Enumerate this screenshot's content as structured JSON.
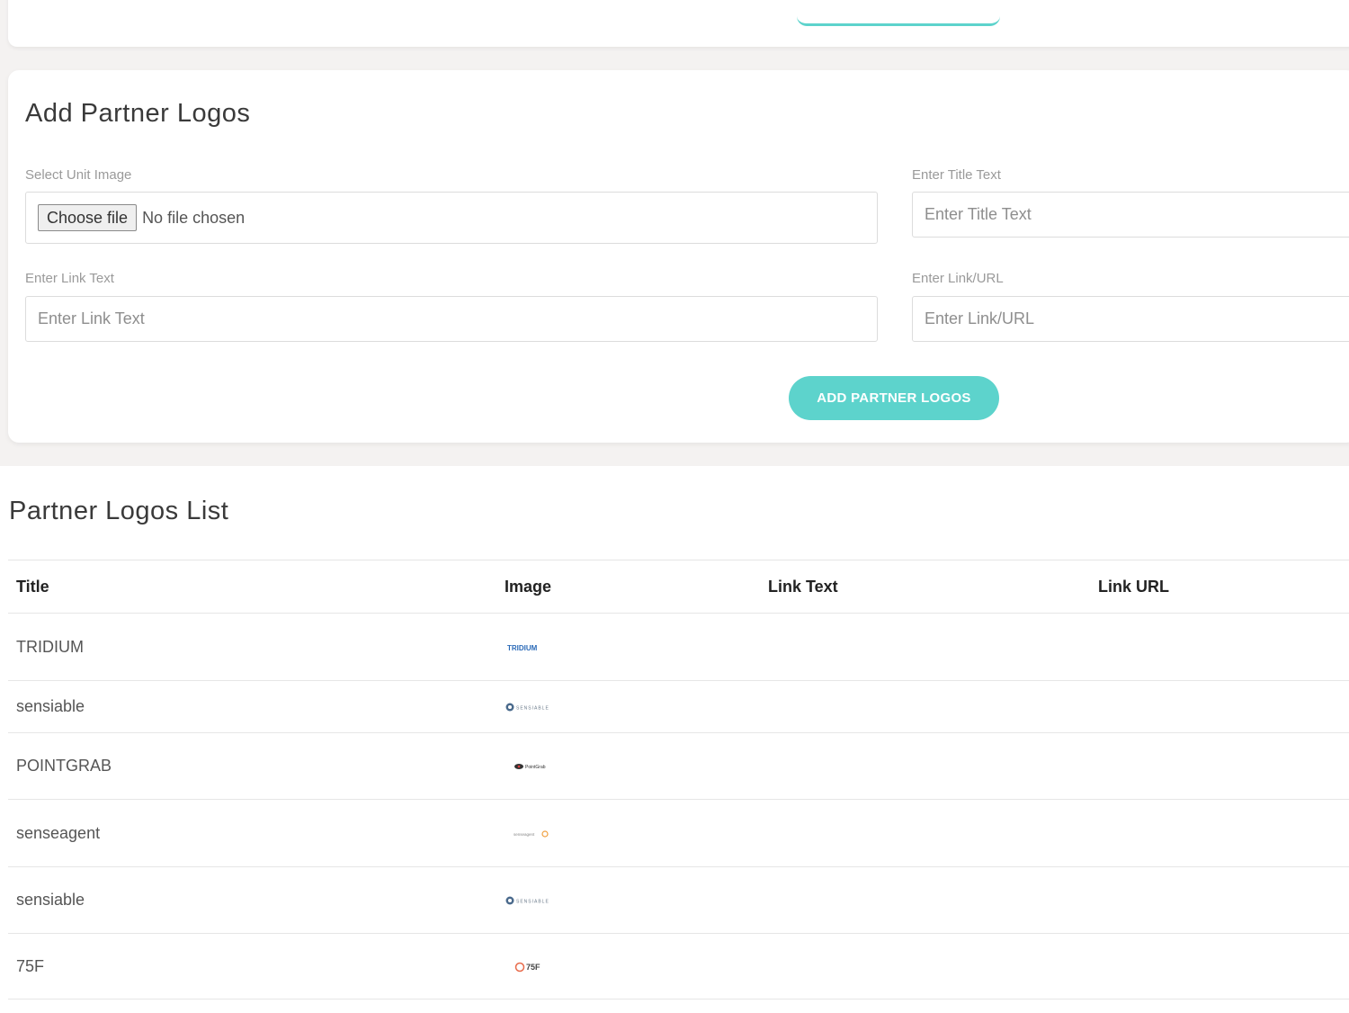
{
  "form": {
    "title": "Add Partner Logos",
    "unit_image_label": "Select Unit Image",
    "choose_file_label": "Choose file",
    "no_file_text": "No file chosen",
    "title_text_label": "Enter Title Text",
    "title_text_placeholder": "Enter Title Text",
    "link_text_label": "Enter Link Text",
    "link_text_placeholder": "Enter Link Text",
    "link_url_label": "Enter Link/URL",
    "link_url_placeholder": "Enter Link/URL",
    "submit_label": "ADD PARTNER LOGOS"
  },
  "list": {
    "title": "Partner Logos List",
    "columns": [
      "Title",
      "Image",
      "Link Text",
      "Link URL"
    ],
    "rows": [
      {
        "title": "TRIDIUM",
        "logo": "tridium-logo",
        "logo_text": "TRIDIUM",
        "link_text": "",
        "link_url": ""
      },
      {
        "title": "sensiable",
        "logo": "sensiable-logo",
        "logo_text": "SENSIABLE",
        "link_text": "",
        "link_url": ""
      },
      {
        "title": "POINTGRAB",
        "logo": "pointgrab-logo",
        "logo_text": "PointGrab",
        "link_text": "",
        "link_url": ""
      },
      {
        "title": "senseagent",
        "logo": "senseagent-logo",
        "logo_text": "senseagent",
        "link_text": "",
        "link_url": ""
      },
      {
        "title": "sensiable",
        "logo": "sensiable-logo",
        "logo_text": "SENSIABLE",
        "link_text": "",
        "link_url": ""
      },
      {
        "title": "75F",
        "logo": "75f-logo",
        "logo_text": "75F",
        "link_text": "",
        "link_url": ""
      }
    ]
  },
  "colors": {
    "accent": "#5dd3cc",
    "page_background": "#f4f2f1",
    "card_background": "#ffffff"
  }
}
